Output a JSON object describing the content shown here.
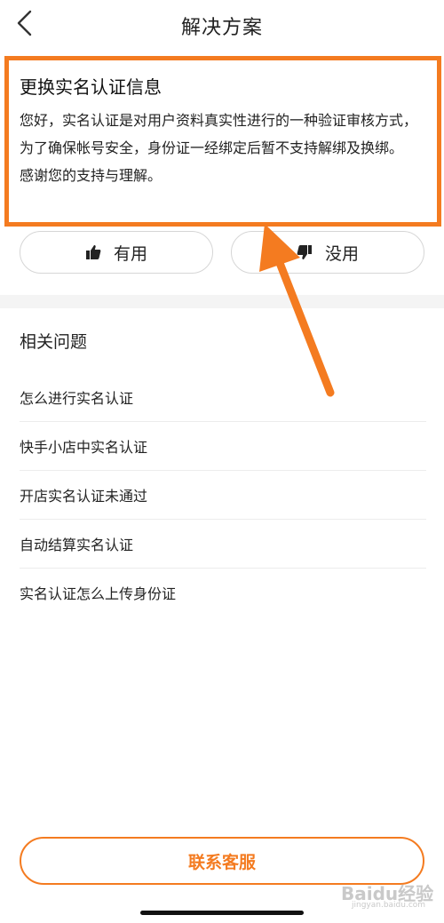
{
  "header": {
    "title": "解决方案",
    "back_icon": "chevron-left-icon"
  },
  "answer": {
    "title": "更换实名认证信息",
    "body_line1": "您好，实名认证是对用户资料真实性进行的一种验证审核方式，为了确保帐号安全，身份证一经绑定后暂不支持解绑及换绑。",
    "body_line2": "感谢您的支持与理解。"
  },
  "feedback": {
    "useful_label": "有用",
    "useless_label": "没用",
    "useful_icon": "thumbs-up-icon",
    "useless_icon": "thumbs-down-icon"
  },
  "related": {
    "title": "相关问题",
    "items": [
      "怎么进行实名认证",
      "快手小店中实名认证",
      "开店实名认证未通过",
      "自动结算实名认证",
      "实名认证怎么上传身份证"
    ]
  },
  "contact": {
    "label": "联系客服"
  },
  "watermark": {
    "brand": "Baidu经验",
    "sub": "jingyan.baidu.com"
  },
  "colors": {
    "accent": "#f47b20",
    "text": "#222222",
    "divider": "#f4f4f4"
  }
}
